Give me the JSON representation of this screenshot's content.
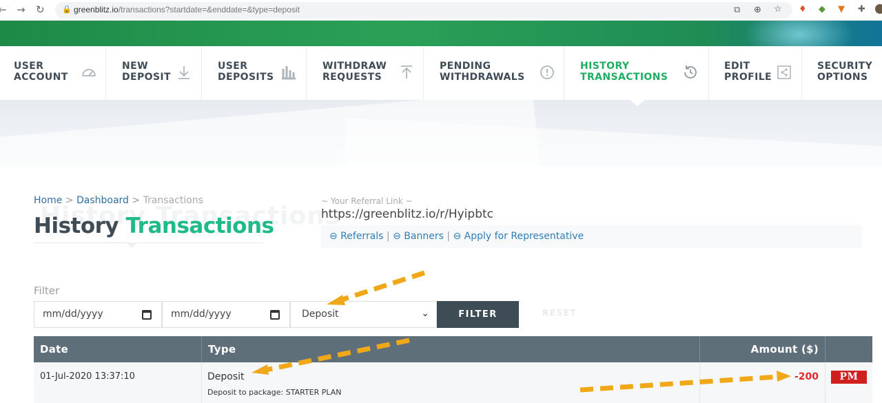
{
  "browser": {
    "url_host": "greenblitz.io",
    "url_path": "/transactions?startdate=&enddate=&type=deposit",
    "icons": [
      "back-icon",
      "forward-icon",
      "reload-icon",
      "lock-icon",
      "translate-icon",
      "zoom-icon",
      "bookmark-star-icon",
      "fire-extension-icon",
      "gem-extension-icon",
      "metamask-fox-icon",
      "puzzle-extensions-icon",
      "profile-avatar-icon"
    ]
  },
  "nav": [
    {
      "line1": "USER",
      "line2": "ACCOUNT",
      "icon": "speedometer-icon",
      "active": false
    },
    {
      "line1": "NEW",
      "line2": "DEPOSIT",
      "icon": "download-arrow-icon",
      "active": false
    },
    {
      "line1": "USER",
      "line2": "DEPOSITS",
      "icon": "bar-chart-icon",
      "active": false
    },
    {
      "line1": "WITHDRAW",
      "line2": "REQUESTS",
      "icon": "upload-arrow-icon",
      "active": false
    },
    {
      "line1": "PENDING",
      "line2": "WITHDRAWALS",
      "icon": "alert-circle-icon",
      "active": false
    },
    {
      "line1": "HISTORY",
      "line2": "TRANSACTIONS",
      "icon": "history-clock-icon",
      "active": true
    },
    {
      "line1": "EDIT",
      "line2": "PROFILE",
      "icon": "share-icon",
      "active": false
    },
    {
      "line1": "SECURITY",
      "line2": "OPTIONS",
      "icon": "",
      "active": false
    }
  ],
  "breadcrumb": {
    "home": "Home",
    "sep1": " > ",
    "dashboard": "Dashboard",
    "sep2": " > ",
    "current": "Transactions"
  },
  "title": {
    "ghost": "History Transactions",
    "part1": "History ",
    "part2": "Transactions"
  },
  "referral": {
    "label": "~ Your Referral Link ~",
    "link": "https://greenblitz.io/r/Hyipbtc",
    "links": [
      "⊖ Referrals",
      "⊖ Banners",
      "⊖ Apply for Representative"
    ],
    "sep": " | "
  },
  "filter": {
    "label": "Filter",
    "start_date": "mm/dd/yyyy",
    "end_date": "mm/dd/yyyy",
    "type_selected": "Deposit",
    "filter_button": "FILTER",
    "reset_button": "RESET"
  },
  "table": {
    "headers": {
      "date": "Date",
      "type": "Type",
      "amount": "Amount ($)"
    },
    "rows": [
      {
        "date": "01-Jul-2020 13:37:10",
        "type": "Deposit",
        "detail": "Deposit to package: STARTER PLAN",
        "amount": "-200",
        "payment": "PM"
      }
    ]
  },
  "colors": {
    "accent": "#1ead63",
    "title_accent": "#1fb98a",
    "header_bg": "#5f6f79",
    "button_bg": "#3d4c55",
    "negative": "#e02a2a",
    "annotation_arrow": "#f0a818"
  }
}
